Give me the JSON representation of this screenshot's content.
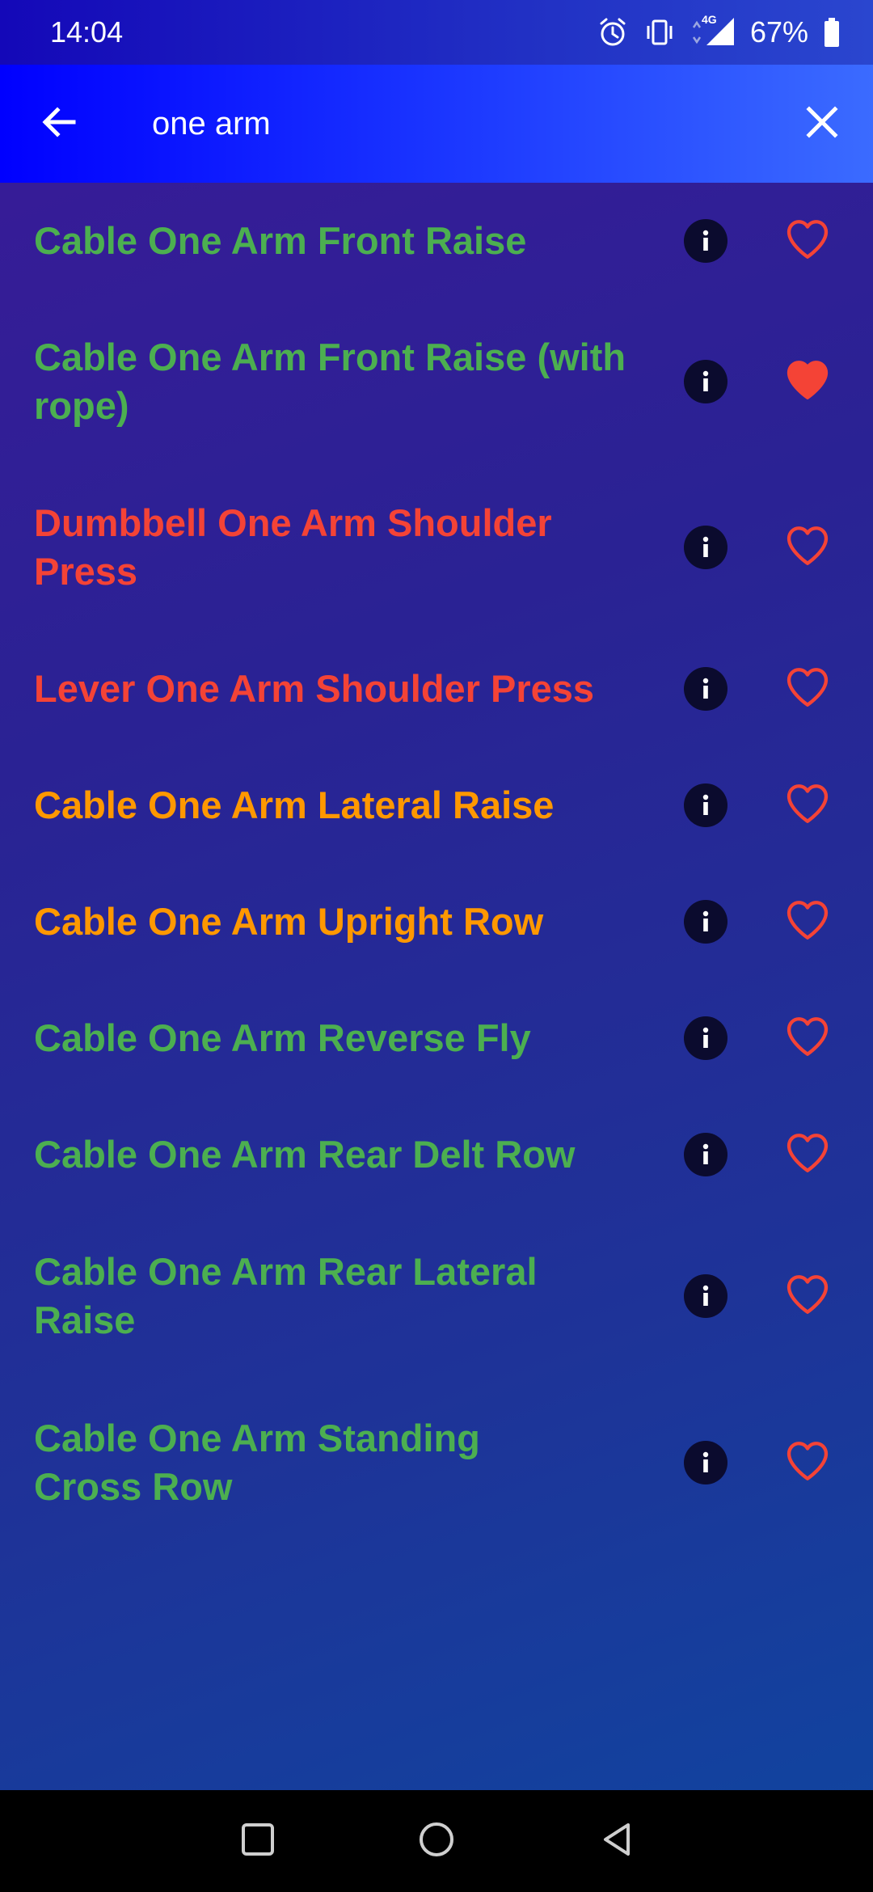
{
  "status_bar": {
    "time": "14:04",
    "network": "4G",
    "battery_percent": "67%",
    "icons": [
      "alarm-icon",
      "vibrate-icon",
      "signal-icon",
      "battery-icon"
    ]
  },
  "search": {
    "query": "one arm",
    "back_icon": "arrow-left-icon",
    "clear_icon": "close-icon"
  },
  "colors": {
    "green": "#4caf50",
    "red": "#f44336",
    "orange": "#ff9800",
    "favorite": "#f44336"
  },
  "results": [
    {
      "title": "Cable One Arm Front Raise",
      "color": "green",
      "favorite": false
    },
    {
      "title": "Cable One Arm Front Raise (with rope)",
      "color": "green",
      "favorite": true
    },
    {
      "title": "Dumbbell One Arm Shoulder Press",
      "color": "red",
      "favorite": false
    },
    {
      "title": "Lever One Arm Shoulder Press",
      "color": "red",
      "favorite": false
    },
    {
      "title": "Cable One Arm Lateral Raise",
      "color": "orange",
      "favorite": false
    },
    {
      "title": "Cable One Arm Upright Row",
      "color": "orange",
      "favorite": false
    },
    {
      "title": "Cable One Arm Reverse Fly",
      "color": "green",
      "favorite": false
    },
    {
      "title": "Cable One Arm Rear Delt Row",
      "color": "green",
      "favorite": false
    },
    {
      "title": "Cable One Arm Rear Lateral Raise",
      "color": "green",
      "favorite": false
    },
    {
      "title": "Cable One Arm Standing Cross Row",
      "color": "green",
      "favorite": false
    }
  ],
  "nav_bar": {
    "buttons": [
      "recents-square-icon",
      "home-circle-icon",
      "back-triangle-icon"
    ]
  }
}
